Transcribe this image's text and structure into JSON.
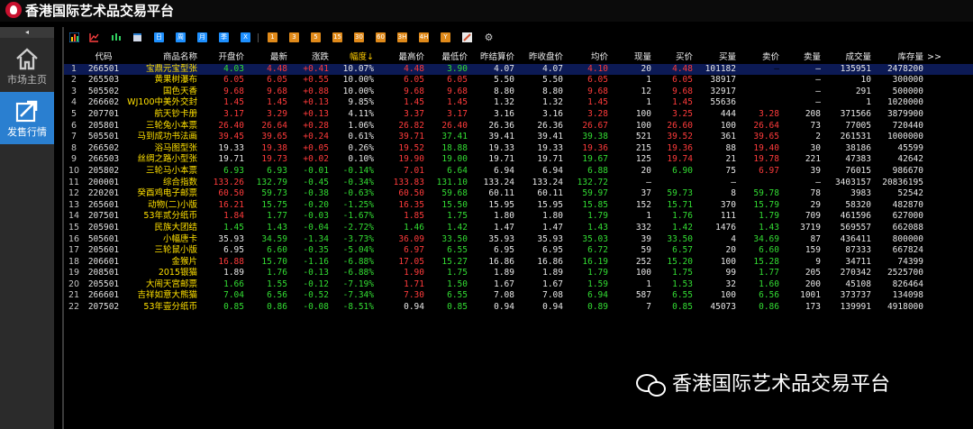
{
  "app": {
    "title": "香港国际艺术品交易平台",
    "brand_color": "#c8102e"
  },
  "sidebar": {
    "collapse_icon": "◂",
    "items": [
      {
        "label": "市场主页",
        "icon": "home-icon"
      },
      {
        "label": "发售行情",
        "icon": "chart-arrow-icon",
        "active": true
      }
    ]
  },
  "toolbar": {
    "buttons": [
      "bar-chart-icon",
      "line-chart-icon",
      "candlestick-icon",
      "report-icon",
      "日",
      "周",
      "月",
      "季",
      "X",
      "1",
      "3",
      "5",
      "15",
      "30",
      "60",
      "3H",
      "4H",
      "Y",
      "pen-icon",
      "gear-icon"
    ]
  },
  "table": {
    "headers": [
      "",
      "代码",
      "商品名称",
      "开盘价",
      "最新",
      "涨跌",
      "幅度↓",
      "最高价",
      "最低价",
      "昨结算价",
      "昨收盘价",
      "均价",
      "现量",
      "买价",
      "买量",
      "卖价",
      "卖量",
      "成交量",
      "库存量"
    ],
    "more_label": ">>",
    "rows": [
      [
        "1",
        "266501",
        "宝鼎元宝型张",
        "4.03",
        "4.48",
        "+0.41",
        "10.07%",
        "4.48",
        "3.90",
        "4.07",
        "4.07",
        "4.10",
        "20",
        "4.48",
        "101182",
        "—",
        "—",
        "135951",
        "2478200"
      ],
      [
        "2",
        "265503",
        "黄果树瀑布",
        "6.05",
        "6.05",
        "+0.55",
        "10.00%",
        "6.05",
        "6.05",
        "5.50",
        "5.50",
        "6.05",
        "1",
        "6.05",
        "38917",
        "—",
        "—",
        "10",
        "300000"
      ],
      [
        "3",
        "505502",
        "国色天香",
        "9.68",
        "9.68",
        "+0.88",
        "10.00%",
        "9.68",
        "9.68",
        "8.80",
        "8.80",
        "9.68",
        "12",
        "9.68",
        "32917",
        "—",
        "—",
        "291",
        "500000"
      ],
      [
        "4",
        "266602",
        "WJ100中美外交封",
        "1.45",
        "1.45",
        "+0.13",
        "9.85%",
        "1.45",
        "1.45",
        "1.32",
        "1.32",
        "1.45",
        "1",
        "1.45",
        "55636",
        "—",
        "—",
        "1",
        "1020000"
      ],
      [
        "5",
        "207701",
        "航天钞卡册",
        "3.17",
        "3.29",
        "+0.13",
        "4.11%",
        "3.37",
        "3.17",
        "3.16",
        "3.16",
        "3.28",
        "100",
        "3.25",
        "444",
        "3.28",
        "208",
        "371566",
        "3879900"
      ],
      [
        "6",
        "205801",
        "三轮兔小本票",
        "26.40",
        "26.64",
        "+0.28",
        "1.06%",
        "26.82",
        "26.40",
        "26.36",
        "26.36",
        "26.67",
        "100",
        "26.60",
        "100",
        "26.64",
        "73",
        "77005",
        "720440"
      ],
      [
        "7",
        "505501",
        "马到成功书法画",
        "39.45",
        "39.65",
        "+0.24",
        "0.61%",
        "39.71",
        "37.41",
        "39.41",
        "39.41",
        "39.38",
        "521",
        "39.52",
        "361",
        "39.65",
        "2",
        "261531",
        "1000000"
      ],
      [
        "8",
        "266502",
        "浴马图型张",
        "19.33",
        "19.38",
        "+0.05",
        "0.26%",
        "19.52",
        "18.88",
        "19.33",
        "19.33",
        "19.36",
        "215",
        "19.36",
        "88",
        "19.40",
        "30",
        "38186",
        "45599"
      ],
      [
        "9",
        "266503",
        "丝绸之路小型张",
        "19.71",
        "19.73",
        "+0.02",
        "0.10%",
        "19.90",
        "19.00",
        "19.71",
        "19.71",
        "19.67",
        "125",
        "19.74",
        "21",
        "19.78",
        "221",
        "47383",
        "42642"
      ],
      [
        "10",
        "205802",
        "三轮马小本票",
        "6.93",
        "6.93",
        "-0.01",
        "-0.14%",
        "7.01",
        "6.64",
        "6.94",
        "6.94",
        "6.88",
        "20",
        "6.90",
        "75",
        "6.97",
        "39",
        "76015",
        "986670"
      ],
      [
        "11",
        "200001",
        "综合指数",
        "133.26",
        "132.79",
        "-0.45",
        "-0.34%",
        "133.83",
        "131.10",
        "133.24",
        "133.24",
        "132.72",
        "—",
        "—",
        "—",
        "—",
        "—",
        "3403157",
        "20836195"
      ],
      [
        "12",
        "220201",
        "癸酉鸡电子邮票",
        "60.50",
        "59.73",
        "-0.38",
        "-0.63%",
        "60.50",
        "59.68",
        "60.11",
        "60.11",
        "59.97",
        "37",
        "59.73",
        "8",
        "59.78",
        "78",
        "3983",
        "52542"
      ],
      [
        "13",
        "265601",
        "动物(二)小版",
        "16.21",
        "15.75",
        "-0.20",
        "-1.25%",
        "16.35",
        "15.50",
        "15.95",
        "15.95",
        "15.85",
        "152",
        "15.71",
        "370",
        "15.79",
        "29",
        "58320",
        "482870"
      ],
      [
        "14",
        "207501",
        "53年贰分纸币",
        "1.84",
        "1.77",
        "-0.03",
        "-1.67%",
        "1.85",
        "1.75",
        "1.80",
        "1.80",
        "1.79",
        "1",
        "1.76",
        "111",
        "1.79",
        "709",
        "461596",
        "627000"
      ],
      [
        "15",
        "205901",
        "民族大团结",
        "1.45",
        "1.43",
        "-0.04",
        "-2.72%",
        "1.46",
        "1.42",
        "1.47",
        "1.47",
        "1.43",
        "332",
        "1.42",
        "1476",
        "1.43",
        "3719",
        "569557",
        "662088"
      ],
      [
        "16",
        "505601",
        "小幅唐卡",
        "35.93",
        "34.59",
        "-1.34",
        "-3.73%",
        "36.09",
        "33.50",
        "35.93",
        "35.93",
        "35.03",
        "39",
        "33.50",
        "4",
        "34.69",
        "87",
        "436411",
        "800000"
      ],
      [
        "17",
        "205601",
        "三轮鼠小版",
        "6.95",
        "6.60",
        "-0.35",
        "-5.04%",
        "6.97",
        "6.55",
        "6.95",
        "6.95",
        "6.72",
        "59",
        "6.57",
        "20",
        "6.60",
        "159",
        "87333",
        "667824"
      ],
      [
        "18",
        "206601",
        "金猴片",
        "16.88",
        "15.70",
        "-1.16",
        "-6.88%",
        "17.05",
        "15.27",
        "16.86",
        "16.86",
        "16.19",
        "252",
        "15.20",
        "100",
        "15.28",
        "9",
        "34711",
        "74399"
      ],
      [
        "19",
        "208501",
        "2015银猫",
        "1.89",
        "1.76",
        "-0.13",
        "-6.88%",
        "1.90",
        "1.75",
        "1.89",
        "1.89",
        "1.79",
        "100",
        "1.75",
        "99",
        "1.77",
        "205",
        "270342",
        "2525700"
      ],
      [
        "20",
        "205501",
        "大闹天宫邮票",
        "1.66",
        "1.55",
        "-0.12",
        "-7.19%",
        "1.71",
        "1.50",
        "1.67",
        "1.67",
        "1.59",
        "1",
        "1.53",
        "32",
        "1.60",
        "200",
        "45108",
        "826464"
      ],
      [
        "21",
        "266601",
        "吉祥如意大熊猫",
        "7.04",
        "6.56",
        "-0.52",
        "-7.34%",
        "7.30",
        "6.55",
        "7.08",
        "7.08",
        "6.94",
        "587",
        "6.55",
        "100",
        "6.56",
        "1001",
        "373737",
        "134098"
      ],
      [
        "22",
        "207502",
        "53年壹分纸币",
        "0.85",
        "0.86",
        "-0.08",
        "-8.51%",
        "0.94",
        "0.85",
        "0.94",
        "0.94",
        "0.89",
        "7",
        "0.85",
        "45073",
        "0.86",
        "173",
        "139991",
        "4918000"
      ]
    ]
  },
  "colors": {
    "up": "#ff3b3b",
    "down": "#33dd33",
    "neutral": "#e6e6e6",
    "name": "#ffe000",
    "header_sorted": "#ffcc00",
    "selected_row": "#0c1a55"
  },
  "watermark": {
    "text": "香港国际艺术品交易平台",
    "icon": "wechat-icon"
  }
}
